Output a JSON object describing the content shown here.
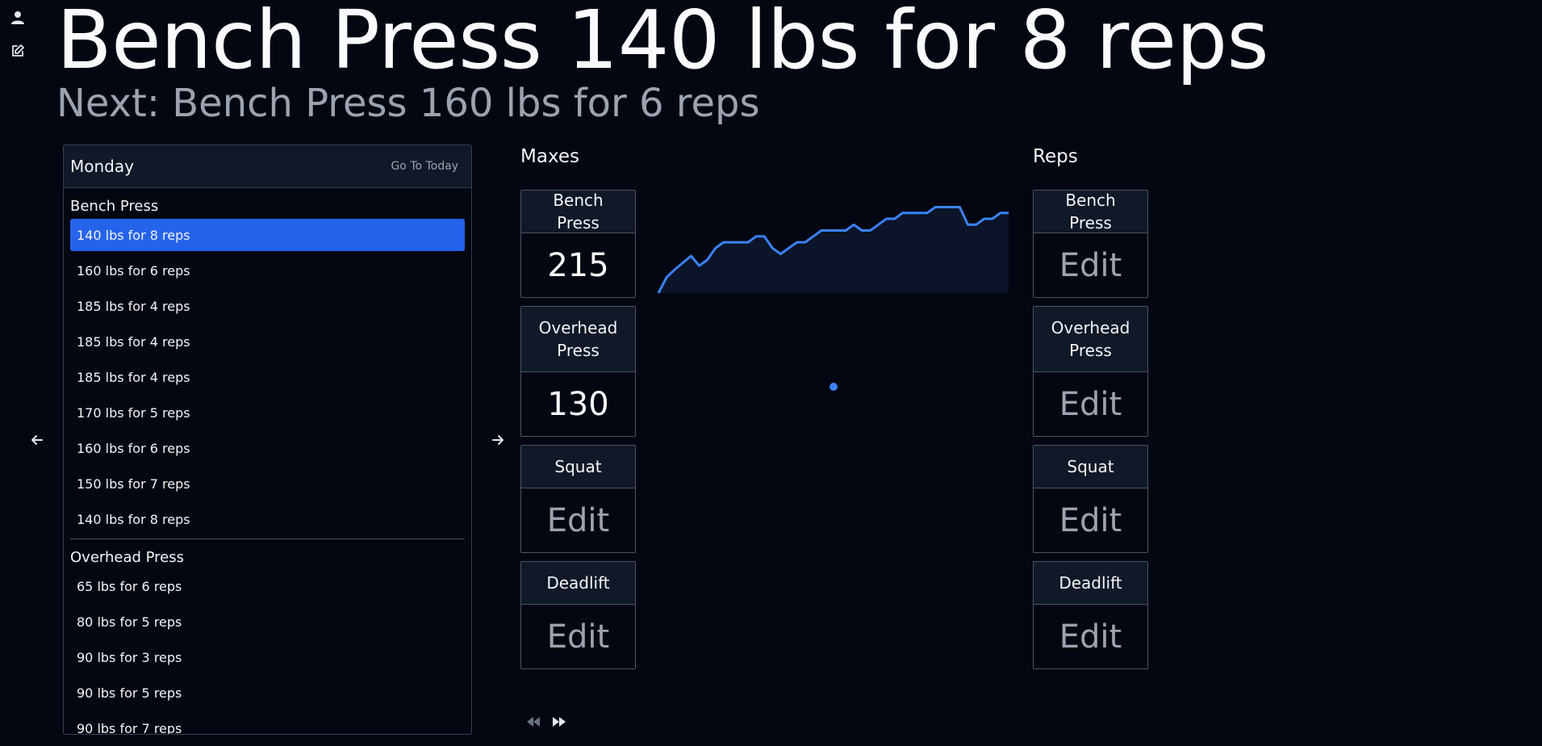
{
  "header": {
    "current_set": "Bench Press 140 lbs for 8 reps",
    "next_set": "Next: Bench Press 160 lbs for 6 reps"
  },
  "rail": {
    "icons": [
      "user-icon",
      "edit-icon"
    ]
  },
  "schedule": {
    "day": "Monday",
    "go_today": "Go To Today",
    "groups": [
      {
        "name": "Bench Press",
        "sets": [
          "140 lbs for 8 reps",
          "160 lbs for 6 reps",
          "185 lbs for 4 reps",
          "185 lbs for 4 reps",
          "185 lbs for 4 reps",
          "170 lbs for 5 reps",
          "160 lbs for 6 reps",
          "150 lbs for 7 reps",
          "140 lbs for 8 reps"
        ]
      },
      {
        "name": "Overhead Press",
        "sets": [
          "65 lbs for 6 reps",
          "80 lbs for 5 reps",
          "90 lbs for 3 reps",
          "90 lbs for 5 reps",
          "90 lbs for 7 reps"
        ]
      }
    ],
    "active_set": "140 lbs for 8 reps"
  },
  "maxes": {
    "title": "Maxes",
    "cards": [
      {
        "name": "Bench Press",
        "value": "215"
      },
      {
        "name": "Overhead Press",
        "value": "130"
      },
      {
        "name": "Squat",
        "value": "Edit"
      },
      {
        "name": "Deadlift",
        "value": "Edit"
      }
    ]
  },
  "reps": {
    "title": "Reps",
    "cards": [
      {
        "name": "Bench Press",
        "value": "Edit"
      },
      {
        "name": "Overhead Press",
        "value": "Edit"
      },
      {
        "name": "Squat",
        "value": "Edit"
      },
      {
        "name": "Deadlift",
        "value": "Edit"
      }
    ]
  },
  "colors": {
    "background": "#030712",
    "accent": "#2563eb",
    "line": "#3b82f6",
    "area": "#0b1428",
    "muted": "#9ca3af"
  },
  "chart_data": {
    "type": "area",
    "title": "",
    "xlabel": "",
    "ylabel": "",
    "x": [
      0,
      1,
      2,
      3,
      4,
      5,
      6,
      7,
      8,
      9,
      10,
      11,
      12,
      13,
      14,
      15,
      16,
      17,
      18,
      19,
      20,
      21,
      22,
      23,
      24,
      25,
      26,
      27,
      28,
      29,
      30,
      31,
      32,
      33,
      34,
      35,
      36,
      37,
      38,
      39,
      40,
      41,
      42,
      43
    ],
    "values": [
      0,
      16,
      24,
      31,
      38,
      28,
      34,
      46,
      52,
      52,
      52,
      52,
      58,
      58,
      46,
      40,
      46,
      52,
      52,
      58,
      64,
      64,
      64,
      64,
      70,
      64,
      64,
      70,
      76,
      76,
      82,
      82,
      82,
      82,
      88,
      88,
      88,
      88,
      70,
      70,
      76,
      76,
      82,
      82
    ],
    "ylim": [
      0,
      95
    ],
    "grid": false,
    "legend": "none"
  }
}
